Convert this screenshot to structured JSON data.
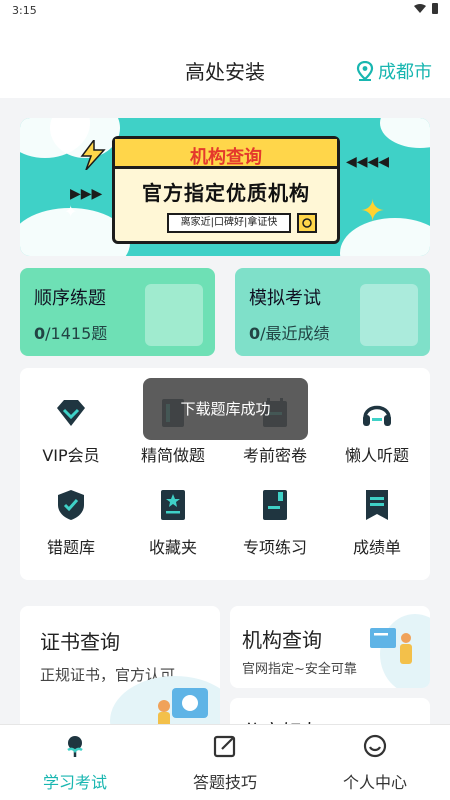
{
  "status_bar": {
    "time": "3:15"
  },
  "header": {
    "title": "高处安装",
    "city": "成都市"
  },
  "banner": {
    "title": "机构查询",
    "subtitle": "官方指定优质机构",
    "tags": "离家近|口碑好|拿证快"
  },
  "practice_cards": [
    {
      "title": "顺序练题",
      "count": "0",
      "suffix": "/1415题"
    },
    {
      "title": "模拟考试",
      "count": "0",
      "suffix": "/最近成绩"
    }
  ],
  "features": [
    {
      "label": "VIP会员",
      "icon": "vip-diamond-icon"
    },
    {
      "label": "精简做题",
      "icon": "book-icon"
    },
    {
      "label": "考前密卷",
      "icon": "calendar-paper-icon"
    },
    {
      "label": "懒人听题",
      "icon": "headphones-icon"
    },
    {
      "label": "错题库",
      "icon": "shield-check-icon"
    },
    {
      "label": "收藏夹",
      "icon": "star-doc-icon"
    },
    {
      "label": "专项练习",
      "icon": "notebook-icon"
    },
    {
      "label": "成绩单",
      "icon": "report-icon"
    }
  ],
  "toast": "下载题库成功",
  "bottom_cards": {
    "certificate": {
      "title": "证书查询",
      "subtitle": "正规证书，官方认可"
    },
    "institution": {
      "title": "机构查询",
      "subtitle": "官网指定~安全可靠"
    },
    "share": {
      "title": "分享好友"
    }
  },
  "tabs": [
    {
      "label": "学习考试",
      "active": true
    },
    {
      "label": "答题技巧",
      "active": false
    },
    {
      "label": "个人中心",
      "active": false
    }
  ],
  "colors": {
    "accent": "#18b6b0",
    "banner_bg": "#3fd1c7",
    "card_green": "#6ee0b5"
  }
}
